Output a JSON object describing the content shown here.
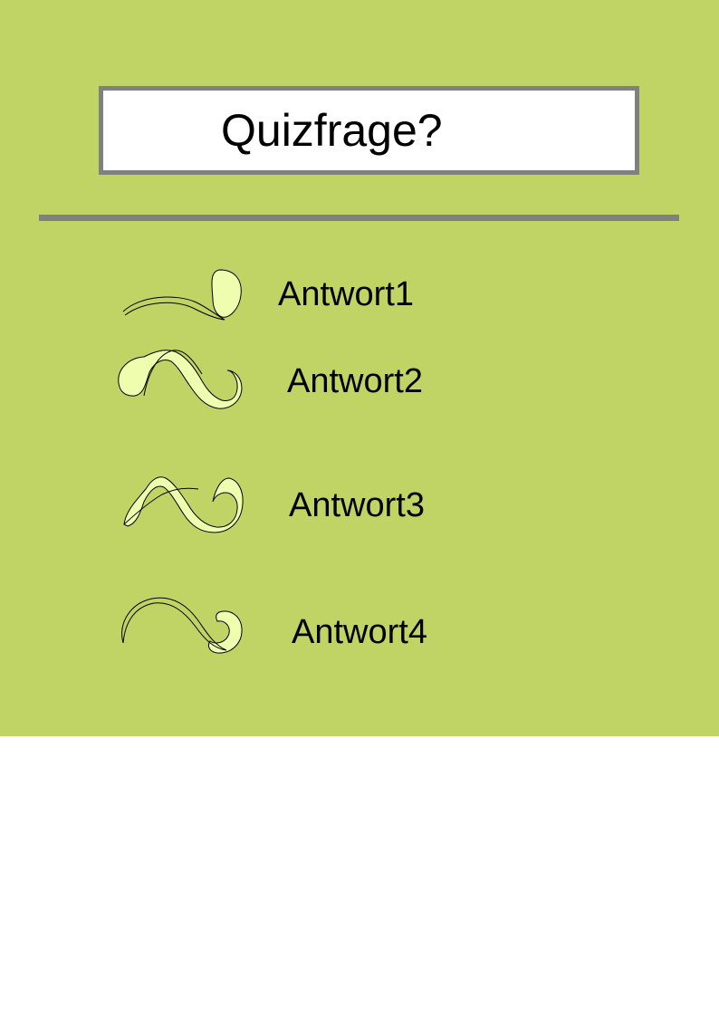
{
  "quiz": {
    "question": "Quizfrage?",
    "answers": [
      {
        "label": "Antwort1",
        "icon": "swirl-ornament-icon"
      },
      {
        "label": "Antwort2",
        "icon": "swirl-ornament-icon"
      },
      {
        "label": "Antwort3",
        "icon": "swirl-ornament-icon"
      },
      {
        "label": "Antwort4",
        "icon": "swirl-ornament-icon"
      }
    ]
  },
  "colors": {
    "background": "#bfd464",
    "frame": "#808080",
    "ornament_fill": "#eefdae",
    "page": "#ffffff"
  }
}
